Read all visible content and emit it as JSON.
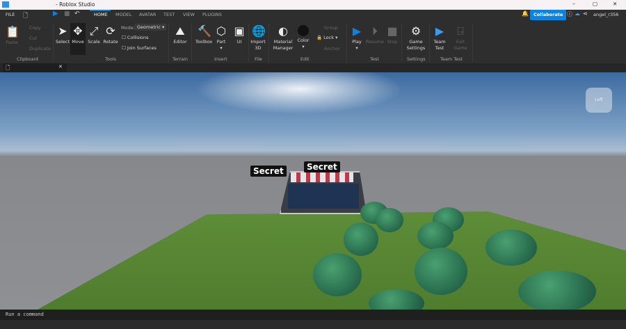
{
  "window": {
    "title": "- Roblox Studio",
    "min": "–",
    "max": "▢",
    "close": "✕"
  },
  "menu": {
    "file": "FILE",
    "tabs": [
      "HOME",
      "MODEL",
      "AVATAR",
      "TEST",
      "VIEW",
      "PLUGINS"
    ],
    "active": "HOME",
    "collaborate": "Collaborate",
    "user": "angel_r356"
  },
  "ribbon": {
    "clipboard": {
      "paste": "Paste",
      "copy": "Copy",
      "cut": "Cut",
      "duplicate": "Duplicate",
      "group": "Clipboard"
    },
    "tools": {
      "select": "Select",
      "move": "Move",
      "scale": "Scale",
      "rotate": "Rotate",
      "mode_label": "Mode:",
      "mode_value": "Geometric",
      "collisions": "Collisions",
      "join": "Join Surfaces",
      "group": "Tools"
    },
    "terrain": {
      "editor": "Editor",
      "group": "Terrain"
    },
    "insert": {
      "toolbox": "Toolbox",
      "part": "Part",
      "ui": "UI",
      "group": "Insert"
    },
    "file": {
      "import": "Import 3D",
      "group": "File"
    },
    "edit": {
      "material": "Material Manager",
      "color": "Color",
      "grp": "Group",
      "lock": "Lock",
      "anchor": "Anchor",
      "group": "Edit"
    },
    "test": {
      "play": "Play",
      "resume": "Resume",
      "stop": "Stop",
      "group": "Test"
    },
    "settings": {
      "game": "Game Settings",
      "group": "Settings"
    },
    "teamtest": {
      "team": "Team Test",
      "exit": "Exit Game",
      "group": "Team Test"
    }
  },
  "viewport": {
    "labels": [
      "Secret",
      "Secret"
    ],
    "viewcube": "Left"
  },
  "command": {
    "placeholder": "Run a command"
  },
  "colors": {
    "accent": "#0a84e0",
    "ribbon": "#2e2e2e",
    "grass": "#5a8a35"
  }
}
